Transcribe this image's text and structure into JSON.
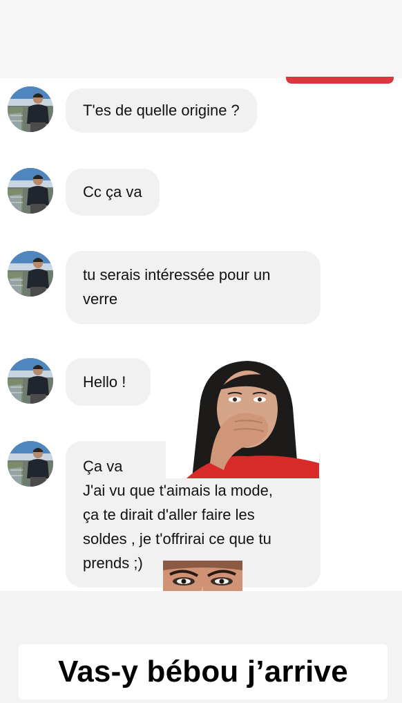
{
  "messages": [
    {
      "lines": [
        "T'es de quelle origine ?"
      ]
    },
    {
      "lines": [
        "Cc ça va"
      ]
    },
    {
      "lines": [
        "tu serais intéressée pour un",
        "verre"
      ]
    },
    {
      "lines": [
        "Hello !"
      ]
    },
    {
      "lines": [
        "Ça va",
        "J'ai vu que t'aimais la mode,",
        "ça te dirait d'aller faire les",
        "soldes , je t'offrirai ce que tu",
        "prends ;)"
      ]
    }
  ],
  "caption": "Vas-y bébou j’arrive",
  "colors": {
    "bubble": "#f1f1f2",
    "accent": "#d9363e",
    "background": "#ffffff"
  }
}
